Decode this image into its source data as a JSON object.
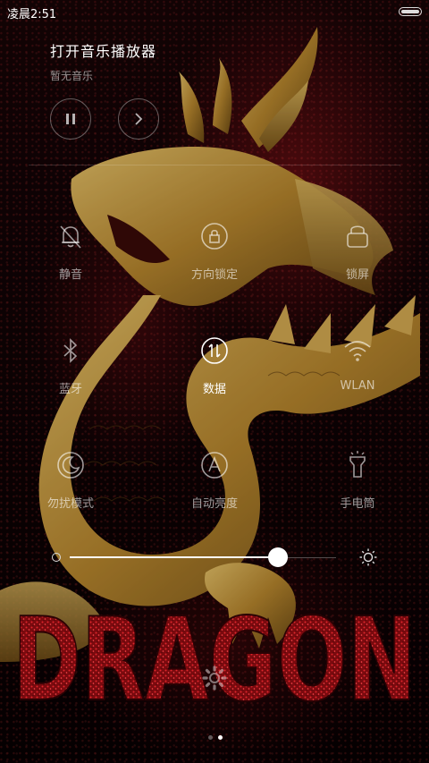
{
  "status_bar": {
    "time": "凌晨2:51",
    "battery_icon": "battery-icon"
  },
  "music": {
    "title": "打开音乐播放器",
    "subtitle": "暂无音乐",
    "play_pause_icon": "pause-icon",
    "next_icon": "next-icon"
  },
  "toggles": [
    {
      "label": "静音",
      "icon": "mute-bell-icon",
      "active": false
    },
    {
      "label": "方向锁定",
      "icon": "rotation-lock-icon",
      "active": false
    },
    {
      "label": "锁屏",
      "icon": "lock-screen-icon",
      "active": false
    },
    {
      "label": "蓝牙",
      "icon": "bluetooth-icon",
      "active": false
    },
    {
      "label": "数据",
      "icon": "mobile-data-icon",
      "active": true
    },
    {
      "label": "WLAN",
      "icon": "wifi-icon",
      "active": false
    },
    {
      "label": "勿扰模式",
      "icon": "moon-icon",
      "active": false
    },
    {
      "label": "自动亮度",
      "icon": "auto-brightness-icon",
      "active": false
    },
    {
      "label": "手电筒",
      "icon": "flashlight-icon",
      "active": false
    }
  ],
  "brightness": {
    "level": 0.7,
    "min_icon": "brightness-low-icon",
    "max_icon": "brightness-high-icon"
  },
  "wallpaper_text": "DRAGON",
  "settings_icon": "gear-icon",
  "pager": {
    "pages": 2,
    "current": 2
  },
  "colors": {
    "accent_red": "#b5151b",
    "gold": "#c89a3a"
  }
}
